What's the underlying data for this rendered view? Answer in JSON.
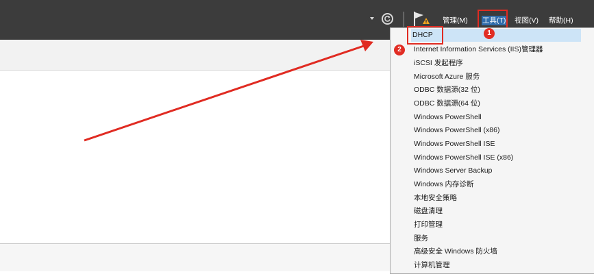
{
  "header": {
    "menus": [
      {
        "label": "管理(M)"
      },
      {
        "label": "工具(T)"
      },
      {
        "label": "视图(V)"
      },
      {
        "label": "帮助(H)"
      }
    ],
    "icons": [
      "dropdown-caret-icon",
      "refresh-icon",
      "notification-flag-icon"
    ]
  },
  "annotations": {
    "badges": [
      "1",
      "2"
    ],
    "highlight_color": "#e02b22"
  },
  "tools_menu": {
    "items": [
      {
        "label": "DHCP"
      },
      {
        "label": "Internet Information Services (IIS)管理器"
      },
      {
        "label": "iSCSI 发起程序"
      },
      {
        "label": "Microsoft Azure 服务"
      },
      {
        "label": "ODBC 数据源(32 位)"
      },
      {
        "label": "ODBC 数据源(64 位)"
      },
      {
        "label": "Windows PowerShell"
      },
      {
        "label": "Windows PowerShell (x86)"
      },
      {
        "label": "Windows PowerShell ISE"
      },
      {
        "label": "Windows PowerShell ISE (x86)"
      },
      {
        "label": "Windows Server Backup"
      },
      {
        "label": "Windows 内存诊断"
      },
      {
        "label": "本地安全策略"
      },
      {
        "label": "磁盘清理"
      },
      {
        "label": "打印管理"
      },
      {
        "label": "服务"
      },
      {
        "label": "高级安全 Windows 防火墙"
      },
      {
        "label": "计算机管理"
      }
    ]
  },
  "colors": {
    "topbar": "#3c3c3c",
    "menu_active": "#2f6cab",
    "selected_item": "#cde4f7",
    "arrow": "#e02b22"
  }
}
